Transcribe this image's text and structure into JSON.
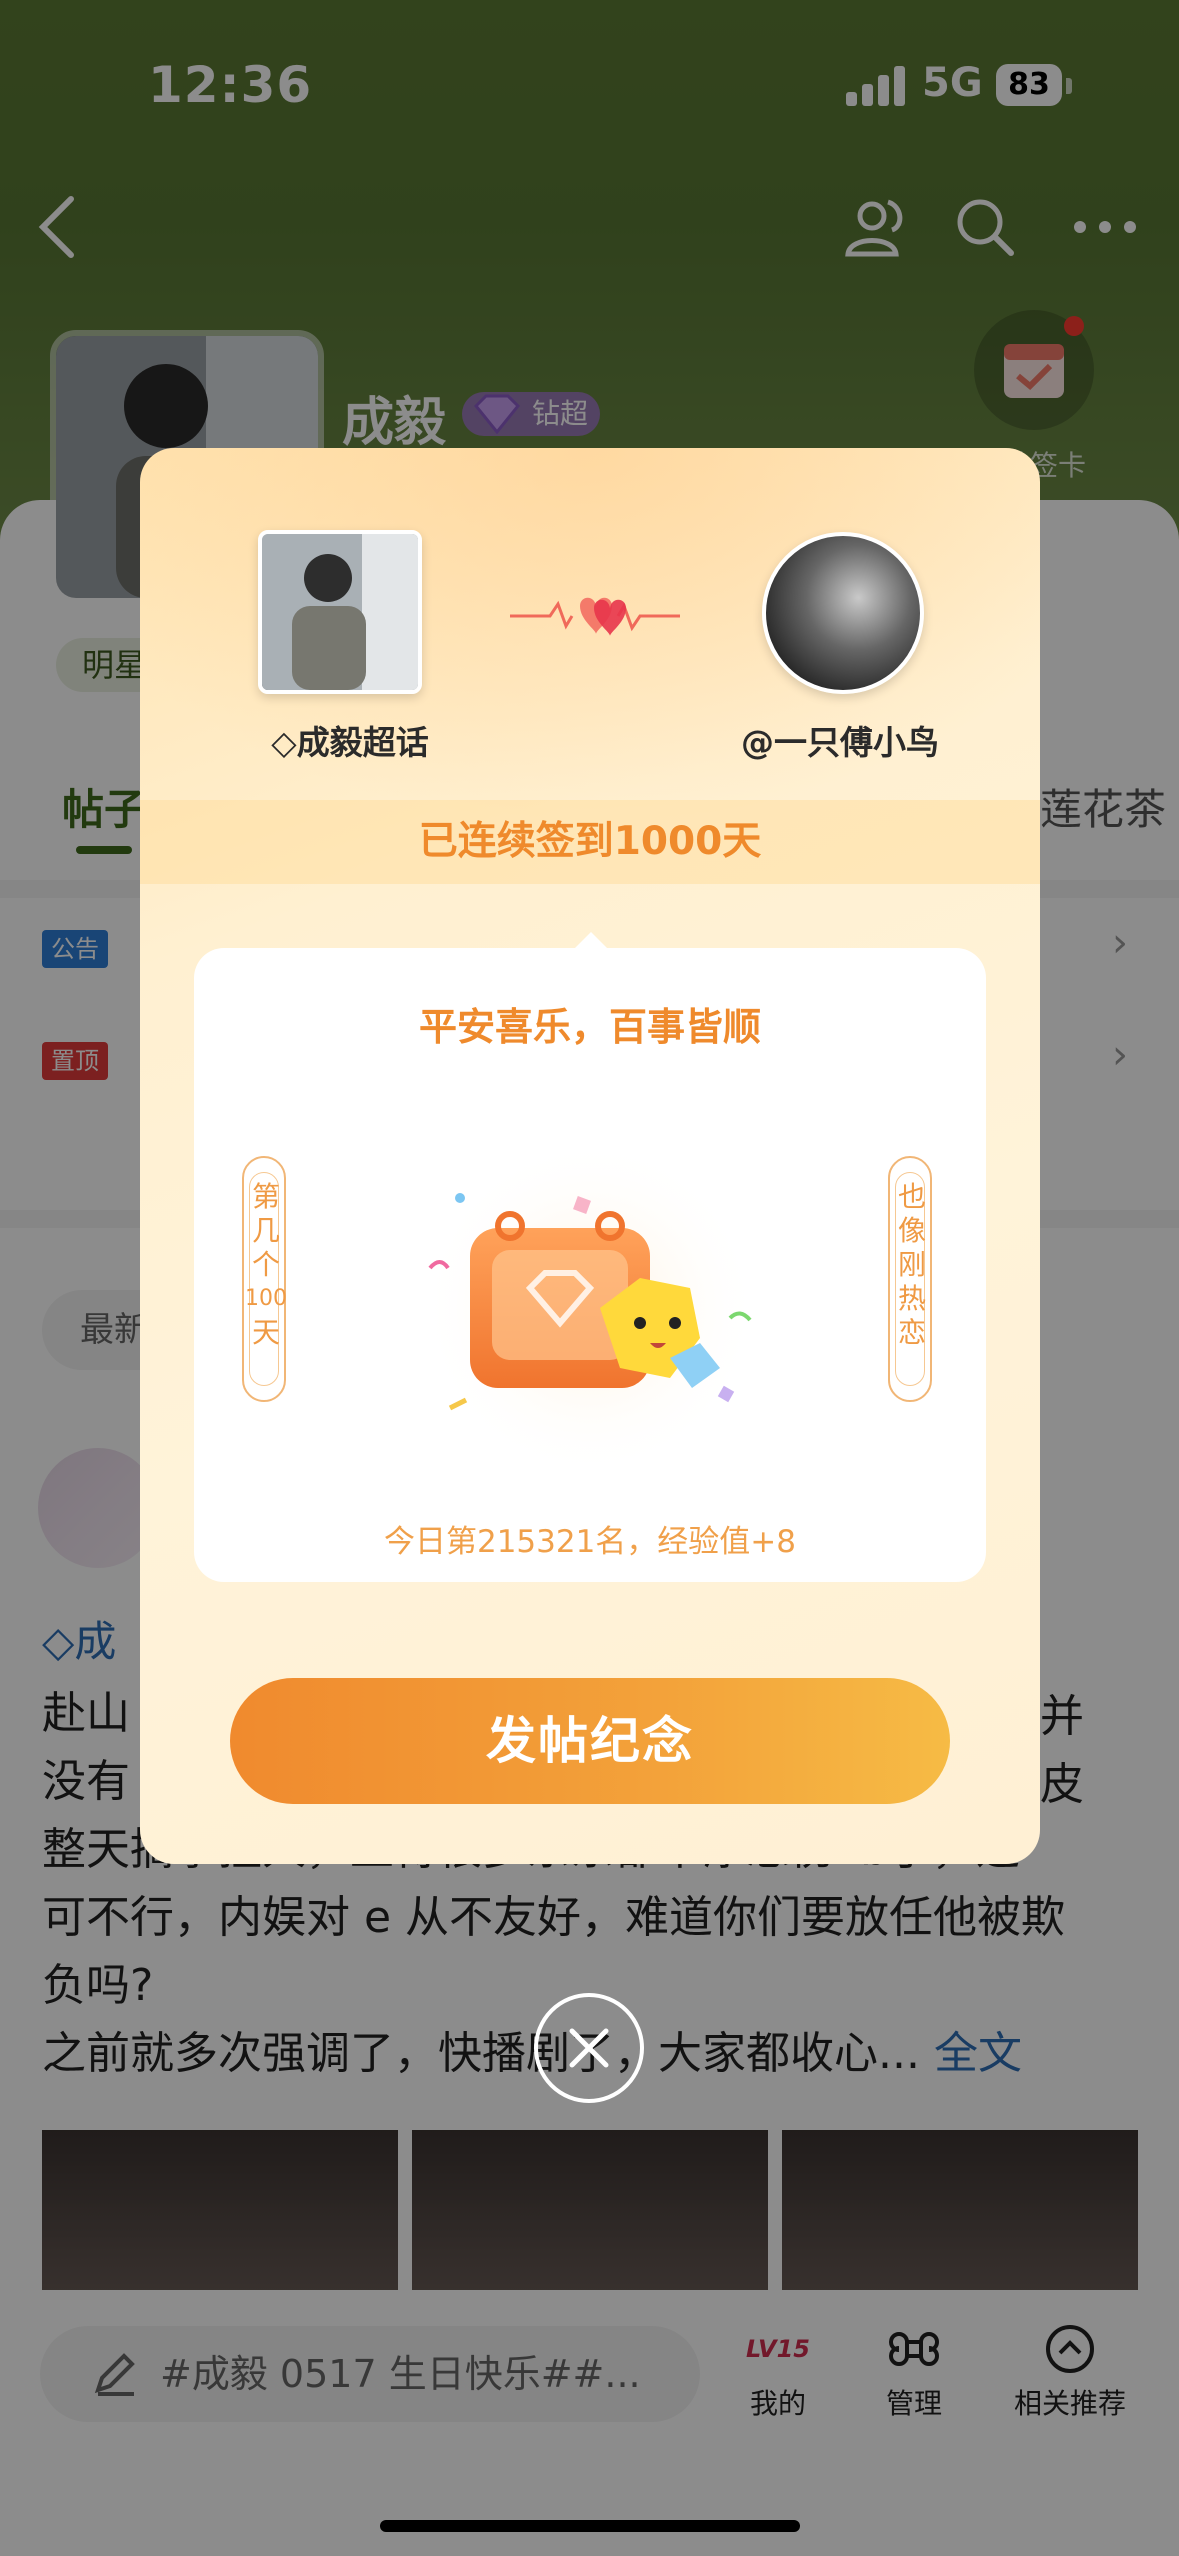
{
  "status_bar": {
    "time": "12:36",
    "network": "5G",
    "battery": "83"
  },
  "page": {
    "title": "成毅",
    "badge": "钻超",
    "sign_card_label": "领社签卡",
    "tag_star": "明星",
    "tab_post": "帖子",
    "tab_right": "莲花茶",
    "notice_chip": "公告",
    "pinned_chip": "置顶",
    "sort_label": "最新",
    "post_tag": "成",
    "post_lines": [
      "赴山",
      "没有",
      "整天搞事扭人，止得很多东东都平添悲伤vb了，这",
      "可不行，内娱对 e 从不友好，难道你们要放任他被欺",
      "负吗?"
    ],
    "post_last_line": "之前就多次强调了，快播剧了，大家都收心...",
    "post_full_text_link": "全文",
    "post_right_fragments": [
      "并",
      "皮"
    ],
    "compose_placeholder": "#成毅 0517 生日快乐##...",
    "bottom_nav": {
      "mine": "我的",
      "manage": "管理",
      "related": "相关推荐"
    },
    "level_badge": "LV15"
  },
  "modal": {
    "left_name": "成毅超话",
    "right_name": "@一只傅小鸟",
    "streak": "已连续签到1000天",
    "blessing": "平安喜乐，百事皆顺",
    "scroll_left": [
      "第",
      "几",
      "个",
      "100",
      "天"
    ],
    "scroll_right": [
      "也",
      "像",
      "刚",
      "热",
      "恋"
    ],
    "rank_text": "今日第215321名，经验值+8",
    "cta_label": "发帖纪念"
  },
  "colors": {
    "accent_orange": "#ef8a2c",
    "cta_start": "#f08a2e",
    "cta_end": "#f6bb45",
    "hero_green": "#5c7a33",
    "link_blue": "#2f6db4"
  }
}
